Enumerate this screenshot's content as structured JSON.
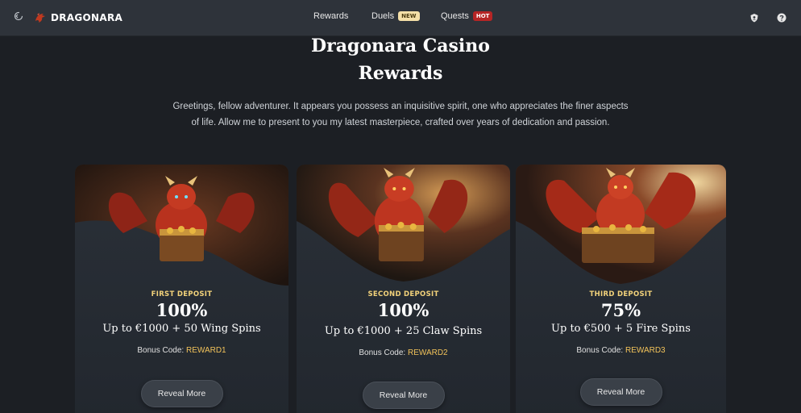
{
  "nav": {
    "brand": "DRAGONARA",
    "links": [
      {
        "label": "Rewards"
      },
      {
        "label": "Duels",
        "badge": "NEW"
      },
      {
        "label": "Quests",
        "badge": "HOT"
      }
    ],
    "icons": [
      "back-icon",
      "dragon-logo-icon",
      "shield-icon",
      "help-icon"
    ]
  },
  "hero": {
    "title_line1": "Dragonara Casino",
    "title_line2": "Rewards",
    "intro_line1": "Greetings, fellow adventurer. It appears you possess an inquisitive spirit, one who appreciates the finer aspects",
    "intro_line2": "of life. Allow me to present to you my latest masterpiece, crafted over years of dedication and passion."
  },
  "cards": [
    {
      "label": "FIRST DEPOSIT",
      "percent": "100%",
      "offer": "Up to €1000 + 50 Wing Spins",
      "code_label": "Bonus Code:",
      "code": "REWARD1",
      "button": "Reveal More"
    },
    {
      "label": "SECOND DEPOSIT",
      "percent": "100%",
      "offer": "Up to €1000 + 25 Claw Spins",
      "code_label": "Bonus Code:",
      "code": "REWARD2",
      "button": "Reveal More"
    },
    {
      "label": "THIRD DEPOSIT",
      "percent": "75%",
      "offer": "Up to €500 + 5 Fire Spins",
      "code_label": "Bonus Code:",
      "code": "REWARD3",
      "button": "Reveal More"
    }
  ],
  "colors": {
    "background": "#1c1f24",
    "nav": "#2e333a",
    "card": "#262b32",
    "gold": "#f2d27a",
    "code": "#f2c35a",
    "dragon_red": "#b8321e"
  }
}
